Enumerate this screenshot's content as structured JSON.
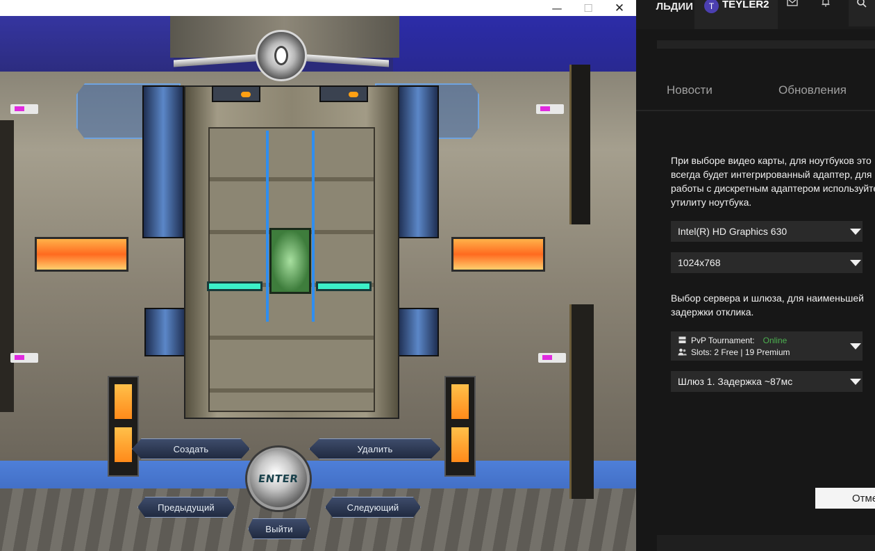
{
  "game": {
    "window_controls": {
      "minimize": "—",
      "maximize": "☐",
      "close": "✕"
    },
    "buttons": {
      "create": "Создать",
      "delete": "Удалить",
      "previous": "Предыдущий",
      "next": "Следующий",
      "exit": "Выйти",
      "enter": "ENTER"
    }
  },
  "launcher": {
    "top_menu_fragment": "ЛЬДИИ",
    "user": {
      "avatar_letter": "T",
      "name": "TEYLER2"
    },
    "icons": {
      "mail": "✉",
      "bell": "🔔",
      "search": "⌕"
    },
    "tabs": [
      {
        "label": "Новости"
      },
      {
        "label": "Обновления"
      }
    ],
    "gpu_note": "При выборе видео карты, для ноутбуков это\nвсегда будет интегрированный адаптер, для\nработы с дискретным адаптером используйте\nутилиту ноутбука.",
    "gpu_select": "Intel(R) HD Graphics 630",
    "resolution_select": "1024x768",
    "server_note": "Выбор сервера и шлюза, для наименьшей\nзадержки отклика.",
    "server": {
      "name": "PvP Tournament:",
      "status": "Online",
      "slots": "Slots: 2 Free | 19 Premium"
    },
    "gateway_select": "Шлюз 1. Задержка ~87мс",
    "cancel_button": "Отмена",
    "colors": {
      "status_online": "#4cb050",
      "panel_bg": "#171717",
      "dropdown_bg": "#2a2a2a"
    }
  }
}
